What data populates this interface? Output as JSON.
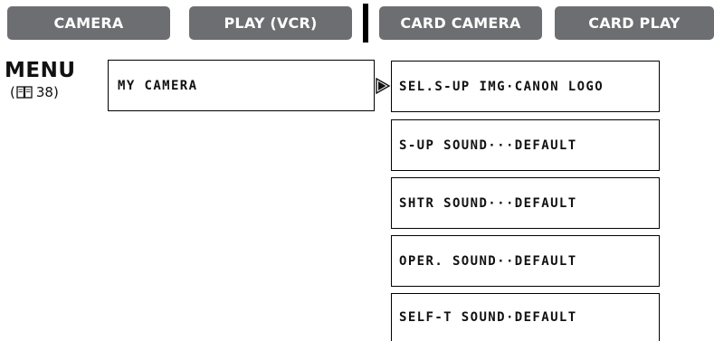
{
  "tabs": {
    "camera": "CAMERA",
    "play_vcr": "PLAY (VCR)",
    "card_camera": "CARD CAMERA",
    "card_play": "CARD PLAY"
  },
  "menu": {
    "label": "MENU",
    "ref_open": "(",
    "ref_page": "38)",
    "ref_icon": "book-icon"
  },
  "submenu": {
    "title": "MY CAMERA",
    "arrow_icon": "arrow-right-icon",
    "items": [
      "SEL.S-UP IMG·CANON LOGO",
      "S-UP SOUND···DEFAULT",
      "SHTR SOUND···DEFAULT",
      "OPER. SOUND··DEFAULT",
      "SELF-T SOUND·DEFAULT"
    ]
  },
  "colors": {
    "tab_background": "#6d6e71",
    "tab_text": "#ffffff",
    "text": "#111111"
  }
}
